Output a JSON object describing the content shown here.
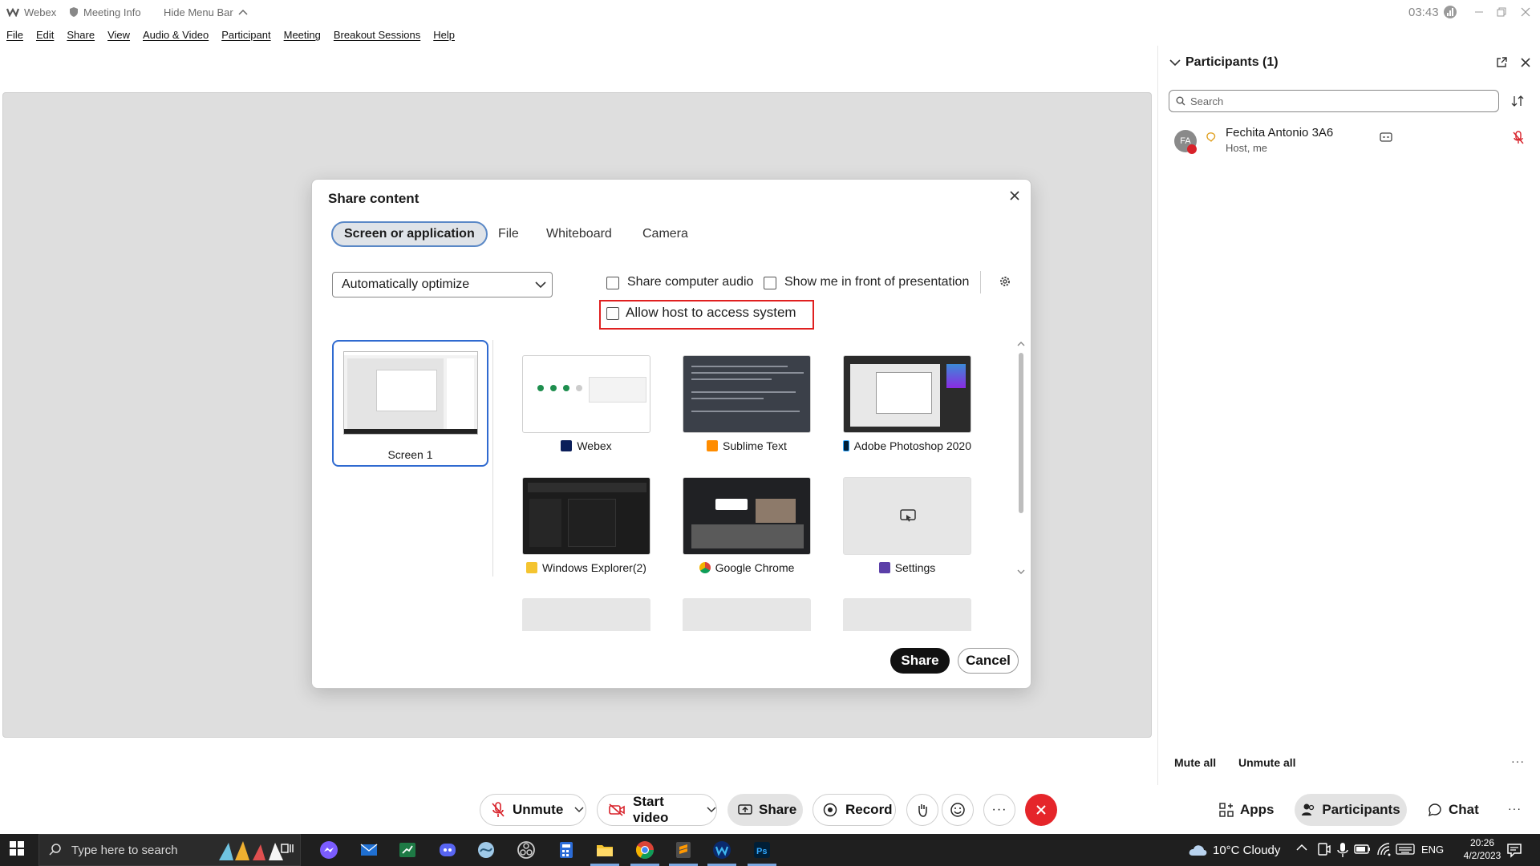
{
  "titlebar": {
    "app_name": "Webex",
    "meeting_info": "Meeting Info",
    "hide_menu_bar": "Hide Menu Bar",
    "timer": "03:43"
  },
  "menubar": [
    "File",
    "Edit",
    "Share",
    "View",
    "Audio & Video",
    "Participant",
    "Meeting",
    "Breakout Sessions",
    "Help"
  ],
  "dialog": {
    "title": "Share content",
    "tabs": [
      "Screen or application",
      "File",
      "Whiteboard",
      "Camera"
    ],
    "active_tab": "Screen or application",
    "optimize_value": "Automatically optimize",
    "share_audio_label": "Share computer audio",
    "show_me_label": "Show me in front of presentation",
    "allow_host_label": "Allow host to access system",
    "screen_label": "Screen 1",
    "apps": [
      {
        "label": "Webex",
        "icon": "webex-icon"
      },
      {
        "label": "Sublime Text",
        "icon": "sublime-icon"
      },
      {
        "label": "Adobe Photoshop 2020",
        "icon": "photoshop-icon"
      },
      {
        "label": "Windows Explorer(2)",
        "icon": "explorer-icon"
      },
      {
        "label": "Google Chrome",
        "icon": "chrome-icon"
      },
      {
        "label": "Settings",
        "icon": "settings-icon"
      }
    ],
    "share_button": "Share",
    "cancel_button": "Cancel"
  },
  "panel": {
    "title": "Participants (1)",
    "search_placeholder": "Search",
    "participant": {
      "initials": "FA",
      "name": "Fechita Antonio 3A6",
      "role": "Host, me"
    },
    "mute_all": "Mute all",
    "unmute_all": "Unmute all"
  },
  "controls": {
    "unmute": "Unmute",
    "start_video": "Start video",
    "share": "Share",
    "record": "Record",
    "apps": "Apps",
    "participants": "Participants",
    "chat": "Chat"
  },
  "taskbar": {
    "search_placeholder": "Type here to search",
    "weather": "10°C  Cloudy",
    "language": "ENG",
    "time": "20:26",
    "date": "4/2/2023"
  },
  "colors": {
    "highlight_border": "#e02020",
    "selected_border": "#2f6ad0",
    "end_call": "#e5252a",
    "taskbar": "#1f1f1f"
  }
}
